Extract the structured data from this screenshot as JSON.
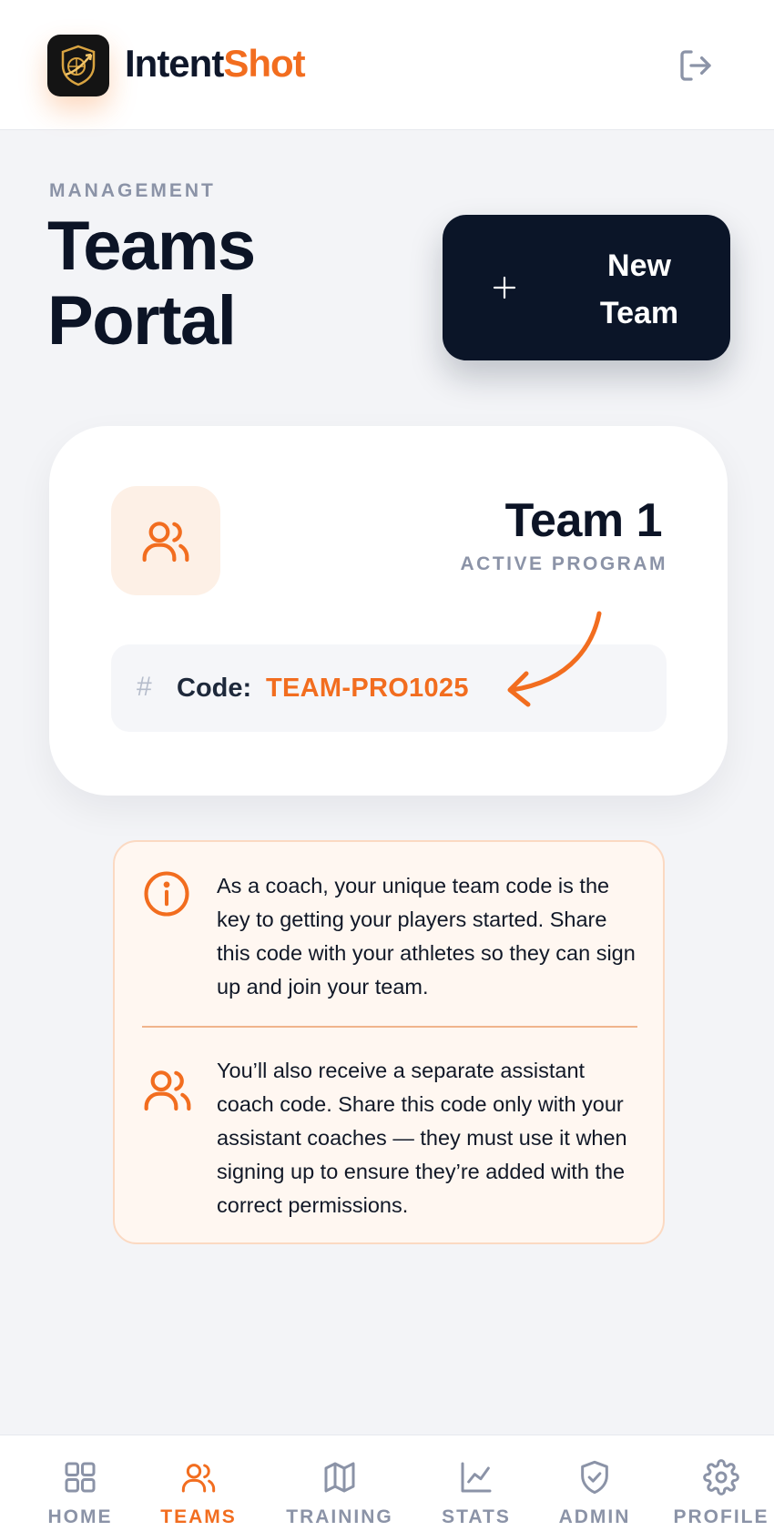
{
  "header": {
    "brand_part1": "Intent",
    "brand_part2": "Shot",
    "logout_icon": "logout-icon"
  },
  "page": {
    "eyebrow": "MANAGEMENT",
    "title_line1": "Teams",
    "title_line2": "Portal",
    "new_team_line1": "New",
    "new_team_line2": "Team"
  },
  "team": {
    "name": "Team 1",
    "status": "ACTIVE PROGRAM",
    "code_hash": "#",
    "code_label": "Code:",
    "code_value": "TEAM-PRO1025"
  },
  "info": {
    "text1": "As a coach, your unique team code is the key to getting your players started. Share this code with your athletes so they can sign up and join your team.",
    "text2": "You’ll also receive a separate assistant coach code. Share this code only with your assistant coaches — they must use it when signing up to ensure they’re added with the correct permissions."
  },
  "nav": {
    "items": [
      {
        "label": "HOME",
        "icon": "grid-icon",
        "active": false
      },
      {
        "label": "TEAMS",
        "icon": "users-icon",
        "active": true
      },
      {
        "label": "TRAINING",
        "icon": "map-icon",
        "active": false
      },
      {
        "label": "STATS",
        "icon": "chart-icon",
        "active": false
      },
      {
        "label": "ADMIN",
        "icon": "shield-icon",
        "active": false
      },
      {
        "label": "PROFILE",
        "icon": "gear-icon",
        "active": false
      }
    ]
  },
  "colors": {
    "accent": "#f26d1f",
    "dark": "#0b1528",
    "muted": "#8b93a7",
    "background": "#f3f4f7"
  }
}
